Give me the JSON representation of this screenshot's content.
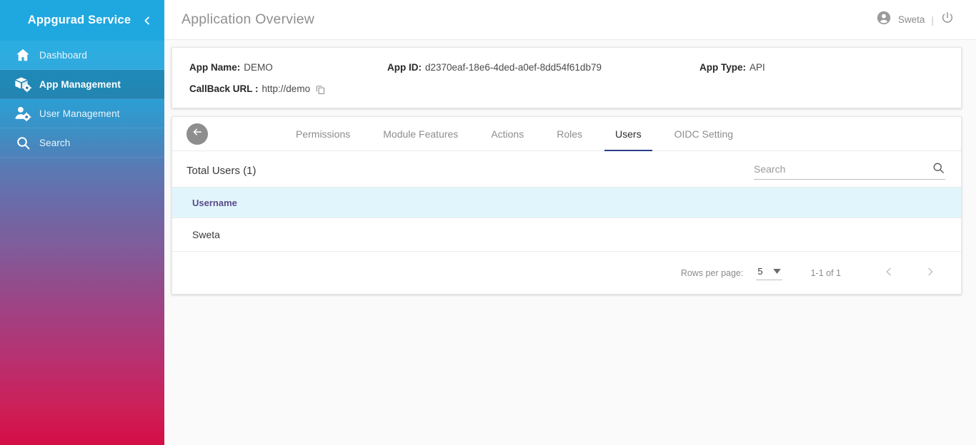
{
  "sidebar": {
    "brand": "Appgurad Service",
    "collapse_icon": "chevron-left-icon",
    "items": [
      {
        "label": "Dashboard",
        "icon": "home-icon",
        "active": false
      },
      {
        "label": "App Management",
        "icon": "box-gear-icon",
        "active": true
      },
      {
        "label": "User Management",
        "icon": "user-gear-icon",
        "active": false
      },
      {
        "label": "Search",
        "icon": "search-icon",
        "active": false
      }
    ],
    "gradient_top": "#1fa8e0",
    "gradient_bottom": "#d50d45"
  },
  "topbar": {
    "title": "Application Overview",
    "account_icon": "account-circle-icon",
    "user_name": "Sweta",
    "divider": "|",
    "power_icon": "power-icon"
  },
  "info_card": {
    "app_name_label": "App Name:",
    "app_name_value": "DEMO",
    "app_id_label": "App ID:",
    "app_id_value": "d2370eaf-18e6-4ded-a0ef-8dd54f61db79",
    "app_type_label": "App Type:",
    "app_type_value": "API",
    "callback_label": "CallBack URL :",
    "callback_value": "http://demo",
    "copy_icon": "copy-icon"
  },
  "tabs_card": {
    "back_icon": "arrow-back-icon",
    "tabs": [
      {
        "label": "Permissions",
        "active": false
      },
      {
        "label": "Module Features",
        "active": false
      },
      {
        "label": "Actions",
        "active": false
      },
      {
        "label": "Roles",
        "active": false
      },
      {
        "label": "Users",
        "active": true
      },
      {
        "label": "OIDC Setting",
        "active": false
      }
    ],
    "active_underline_color": "#2b3d8f"
  },
  "users_panel": {
    "total_users": "Total Users (1)",
    "search": {
      "value": "",
      "placeholder": "Search",
      "icon": "search-icon"
    },
    "table": {
      "columns": [
        "Username"
      ],
      "rows": [
        {
          "username": "Sweta"
        }
      ],
      "header_bg": "#e1f5fc",
      "header_color": "#5b4b8a"
    },
    "pagination": {
      "rows_per_page_label": "Rows per page:",
      "rows_per_page_value": "5",
      "dropdown_icon": "caret-down-icon",
      "range": "1-1 of 1",
      "prev_icon": "chevron-left-icon",
      "next_icon": "chevron-right-icon"
    }
  }
}
